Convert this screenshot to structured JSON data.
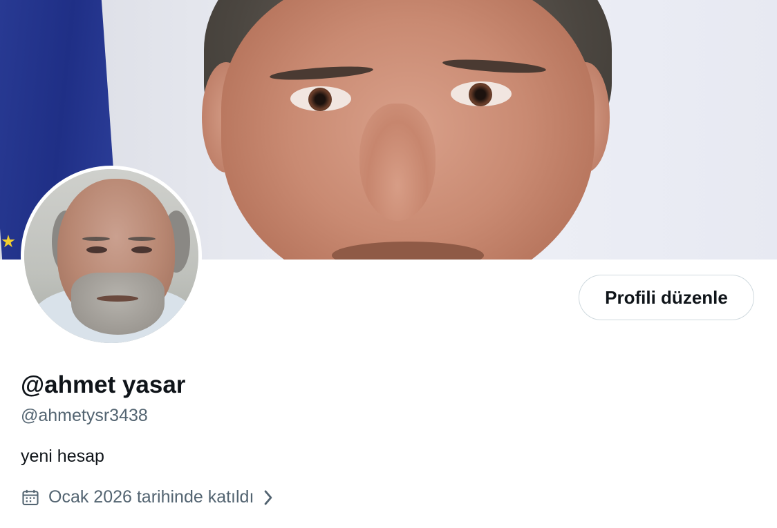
{
  "profile": {
    "display_name": "@ahmet yasar",
    "handle": "@ahmetysr3438",
    "bio": "yeni hesap",
    "joined": "Ocak 2026 tarihinde katıldı",
    "edit_button": "Profili düzenle"
  },
  "icons": {
    "joined": "calendar-icon",
    "joined_more": "chevron-right-icon"
  },
  "colors": {
    "primary_text": "#0f1419",
    "secondary_text": "#536471",
    "button_border": "#cfd9de"
  }
}
